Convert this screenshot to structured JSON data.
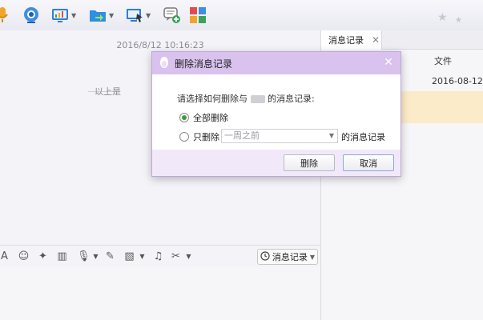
{
  "toolbar": {
    "icons": [
      "mic-icon",
      "camera-icon",
      "screen-share-icon",
      "file-transfer-icon",
      "remote-desktop-icon",
      "create-group-icon",
      "apps-icon"
    ]
  },
  "chat": {
    "timestamp": "2016/8/12 10:16:23",
    "earlier_text": "以上是"
  },
  "input_bar": {
    "message_record_label": "消息记录"
  },
  "right_panel": {
    "tab_label": "消息记录",
    "columns": [
      "文件"
    ],
    "rows": [
      {
        "date": "2016-08-12"
      }
    ]
  },
  "dialog": {
    "title": "删除消息记录",
    "prompt": "请选择如何删除与",
    "prompt_suffix": "的消息记录:",
    "option_all": "全部删除",
    "option_only": "只删除",
    "range_selected": "一周之前",
    "range_suffix": "的消息记录",
    "delete_button": "删除",
    "cancel_button": "取消"
  },
  "colors": {
    "dialog_title_bg": "#d9c2ee",
    "dialog_footer_bg": "#f1e9f9",
    "selected_row_bg": "#fcebc8",
    "radio_accent": "#3a9d3a"
  }
}
